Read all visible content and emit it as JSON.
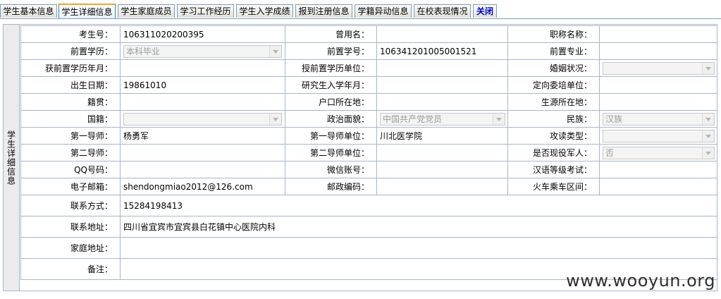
{
  "tabs": [
    {
      "label": "学生基本信息"
    },
    {
      "label": "学生详细信息"
    },
    {
      "label": "学生家庭成员"
    },
    {
      "label": "学习工作经历"
    },
    {
      "label": "学生入学成绩"
    },
    {
      "label": "报到注册信息"
    },
    {
      "label": "学籍异动信息"
    },
    {
      "label": "在校表现情况"
    },
    {
      "label": "关闭"
    }
  ],
  "section_title": "学生详细信息",
  "fields": {
    "exam_no": {
      "label": "考生号：",
      "value": "106311020200395"
    },
    "former_name": {
      "label": "曾用名：",
      "value": ""
    },
    "job_title": {
      "label": "职称名称：",
      "value": ""
    },
    "prev_degree": {
      "label": "前置学历：",
      "value": "本科毕业"
    },
    "prev_degree_no": {
      "label": "前置学号：",
      "value": "106341201005001521"
    },
    "prev_major": {
      "label": "前置专业：",
      "value": ""
    },
    "prev_degree_date": {
      "label": "获前置学历年月：",
      "value": ""
    },
    "prev_degree_unit": {
      "label": "授前置学历单位：",
      "value": ""
    },
    "marital": {
      "label": "婚姻状况：",
      "value": ""
    },
    "birth_date": {
      "label": "出生日期：",
      "value": "19861010"
    },
    "grad_entry": {
      "label": "研究生入学年月：",
      "value": ""
    },
    "directed_unit": {
      "label": "定向委培单位：",
      "value": ""
    },
    "native_place": {
      "label": "籍贯：",
      "value": ""
    },
    "hukou": {
      "label": "户口所在地：",
      "value": ""
    },
    "origin": {
      "label": "生源所在地：",
      "value": ""
    },
    "nationality": {
      "label": "国籍：",
      "value": ""
    },
    "political": {
      "label": "政治面貌：",
      "value": "中国共产党党员"
    },
    "ethnicity": {
      "label": "民族：",
      "value": "汉族"
    },
    "advisor1": {
      "label": "第一导师：",
      "value": "杨勇军"
    },
    "advisor1_unit": {
      "label": "第一导师单位：",
      "value": "川北医学院"
    },
    "study_type": {
      "label": "攻读类型：",
      "value": ""
    },
    "advisor2": {
      "label": "第二导师：",
      "value": ""
    },
    "advisor2_unit": {
      "label": "第二导师单位：",
      "value": ""
    },
    "military": {
      "label": "是否现役军人：",
      "value": "否"
    },
    "qq": {
      "label": "QQ号码：",
      "value": ""
    },
    "wechat": {
      "label": "微信账号：",
      "value": ""
    },
    "hsk": {
      "label": "汉语等级考试：",
      "value": ""
    },
    "email": {
      "label": "电子邮箱：",
      "value": "shendongmiao2012@126.com"
    },
    "postcode": {
      "label": "邮政编码：",
      "value": ""
    },
    "train": {
      "label": "火车乘车区间：",
      "value": ""
    },
    "contact": {
      "label": "联系方式：",
      "value": "15284198413"
    },
    "address": {
      "label": "联系地址：",
      "value": "四川省宜宾市宜宾县白花镇中心医院内科"
    },
    "home_address": {
      "label": "家庭地址：",
      "value": ""
    },
    "remarks": {
      "label": "备注：",
      "value": ""
    }
  },
  "watermark": "www.wooyun.org"
}
